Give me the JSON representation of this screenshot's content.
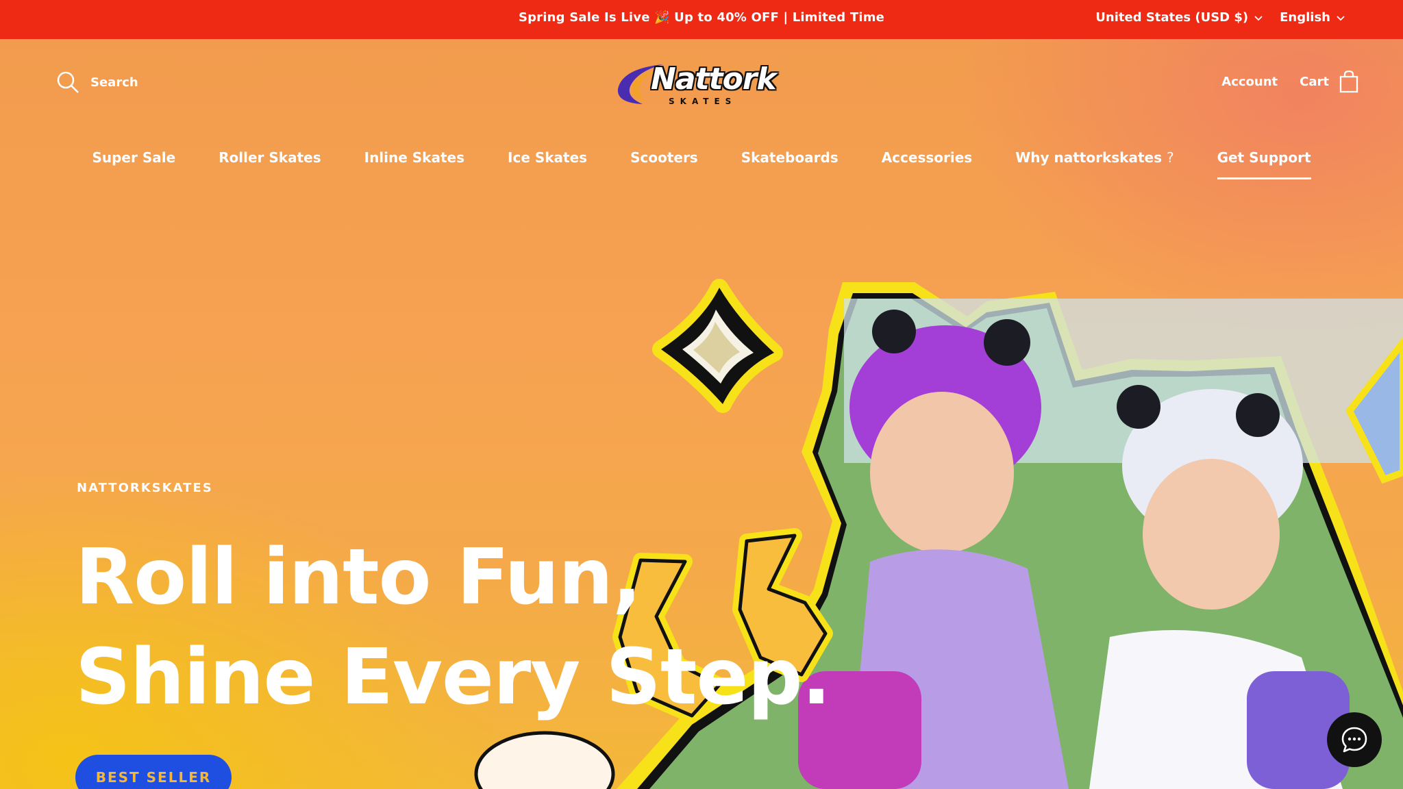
{
  "announcement": {
    "text": "Spring Sale Is Live 🎉 Up to 40% OFF | Limited Time",
    "currency": "United States (USD $)",
    "language": "English"
  },
  "header": {
    "search_label": "Search",
    "logo_text": "Nattork",
    "logo_subtext": "SKATES",
    "account_label": "Account",
    "cart_label": "Cart"
  },
  "nav": {
    "items": [
      {
        "label": "Super Sale"
      },
      {
        "label": "Roller Skates"
      },
      {
        "label": "Inline Skates"
      },
      {
        "label": "Ice Skates"
      },
      {
        "label": "Scooters"
      },
      {
        "label": "Skateboards"
      },
      {
        "label": "Accessories"
      },
      {
        "label": "Why nattorkskates",
        "suffix": "?"
      },
      {
        "label": "Get Support",
        "active": true
      }
    ]
  },
  "hero": {
    "eyebrow": "NATTORKSKATES",
    "headline_line1": "Roll into Fun,",
    "headline_line2": "Shine Every Step.",
    "cta_label": "BEST SELLER"
  },
  "colors": {
    "announcement_bg": "#ee2a14",
    "cta_bg": "#1f4fe0",
    "cta_text": "#f5b73a",
    "accent_yellow": "#f7e21a"
  },
  "icons": [
    "search-icon",
    "chevron-down-icon",
    "cart-bag-icon",
    "chat-icon"
  ]
}
